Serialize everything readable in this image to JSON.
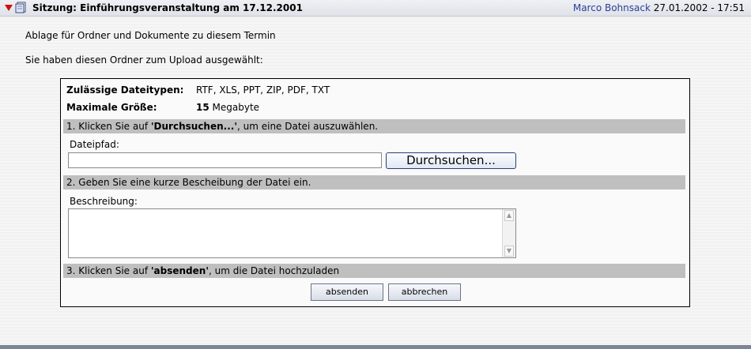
{
  "header": {
    "title": "Sitzung: Einführungsveranstaltung am 17.12.2001",
    "user": "Marco Bohnsack",
    "datetime": "27.01.2002 - 17:51"
  },
  "intro": {
    "line1": "Ablage für Ordner und Dokumente zu diesem Termin",
    "line2": "Sie haben diesen Ordner zum Upload ausgewählt:"
  },
  "upload": {
    "types_label": "Zulässige Dateitypen:",
    "types_value": "RTF, XLS, PPT, ZIP, PDF, TXT",
    "maxsize_label": "Maximale Größe:",
    "maxsize_number": "15",
    "maxsize_unit": "Megabyte",
    "step1_pre": "1. Klicken Sie auf ",
    "step1_bold": "'Durchsuchen...'",
    "step1_post": ", um eine Datei auszuwählen.",
    "path_label": "Dateipfad:",
    "path_value": "",
    "browse_label": "Durchsuchen...",
    "step2": "2. Geben Sie eine kurze Bescheibung der Datei ein.",
    "desc_label": "Beschreibung:",
    "desc_value": "",
    "step3_pre": "3. Klicken Sie auf ",
    "step3_bold": "'absenden'",
    "step3_post": ", um die Datei hochzuladen",
    "submit_label": "absenden",
    "cancel_label": "abbrechen"
  },
  "colors": {
    "header_user": "#2c3f9a",
    "arrow": "#cc1111",
    "bar": "#bfbfbf"
  },
  "icons": {
    "collapse": "triangle-down-icon",
    "document": "document-icon"
  }
}
